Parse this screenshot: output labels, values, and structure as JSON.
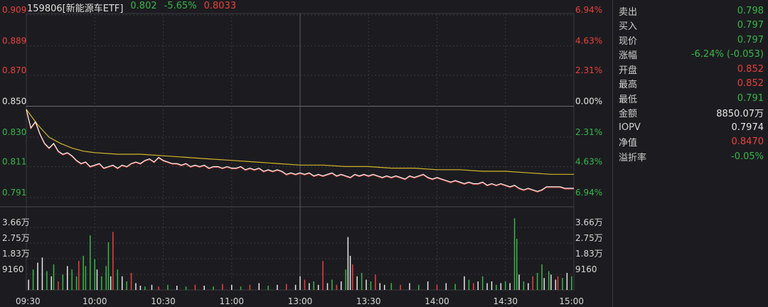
{
  "header": {
    "name": "159806[新能源车ETF]",
    "price": "0.802",
    "change_pct": "-5.65%",
    "avg_price": "0.8033"
  },
  "quote": [
    {
      "label": "卖出",
      "value": "0.798",
      "color": "green"
    },
    {
      "label": "买入",
      "value": "0.797",
      "color": "green"
    },
    {
      "label": "现价",
      "value": "0.797",
      "color": "green"
    },
    {
      "label": "涨幅",
      "value": "-6.24% (-0.053)",
      "color": "green"
    },
    {
      "label": "开盘",
      "value": "0.852",
      "color": "red"
    },
    {
      "label": "最高",
      "value": "0.852",
      "color": "red"
    },
    {
      "label": "最低",
      "value": "0.791",
      "color": "green"
    },
    {
      "label": "金额",
      "value": "8850.07万",
      "color": "white"
    },
    {
      "label": "IOPV",
      "value": "0.7974",
      "color": "white"
    },
    {
      "label": "净值",
      "value": "0.8470",
      "color": "red"
    },
    {
      "label": "溢折率",
      "value": "-0.05%",
      "color": "green"
    }
  ],
  "colors": {
    "up": "#e8413c",
    "down": "#39b54a",
    "flat": "#e6e6e6",
    "avg_line": "#d4b42a",
    "price_line": "#ffffff",
    "grid": "#3a3a3e"
  },
  "chart_data": {
    "type": "line",
    "prev_close": 0.85,
    "price_axis": {
      "ylim": [
        0.791,
        0.909
      ],
      "left_ticks": [
        {
          "value": 0.909,
          "label": "0.909",
          "color": "red"
        },
        {
          "value": 0.889,
          "label": "0.889",
          "color": "red"
        },
        {
          "value": 0.87,
          "label": "0.870",
          "color": "red"
        },
        {
          "value": 0.85,
          "label": "0.850",
          "color": "white"
        },
        {
          "value": 0.83,
          "label": "0.830",
          "color": "green"
        },
        {
          "value": 0.811,
          "label": "0.811",
          "color": "green"
        },
        {
          "value": 0.791,
          "label": "0.791",
          "color": "green"
        }
      ],
      "right_ticks": [
        {
          "value": 0.909,
          "label": "6.94%",
          "color": "red"
        },
        {
          "value": 0.889,
          "label": "4.63%",
          "color": "red"
        },
        {
          "value": 0.87,
          "label": "2.31%",
          "color": "red"
        },
        {
          "value": 0.85,
          "label": "0.00%",
          "color": "white"
        },
        {
          "value": 0.83,
          "label": "2.31%",
          "color": "green"
        },
        {
          "value": 0.811,
          "label": "4.63%",
          "color": "green"
        },
        {
          "value": 0.791,
          "label": "6.94%",
          "color": "green"
        }
      ]
    },
    "volume_axis": {
      "ylim": [
        0,
        45000
      ],
      "ticks": [
        {
          "value": 36600,
          "label": "3.66万"
        },
        {
          "value": 27500,
          "label": "2.75万"
        },
        {
          "value": 18300,
          "label": "1.83万"
        },
        {
          "value": 9160,
          "label": "9160"
        }
      ]
    },
    "x_ticks": [
      "09:30",
      "10:00",
      "10:30",
      "11:00",
      "13:00",
      "13:30",
      "14:00",
      "14:30",
      "15:00"
    ],
    "price_series": {
      "name": "price",
      "points": [
        [
          0,
          0.848
        ],
        [
          2,
          0.836
        ],
        [
          4,
          0.84
        ],
        [
          6,
          0.832
        ],
        [
          8,
          0.826
        ],
        [
          10,
          0.823
        ],
        [
          12,
          0.826
        ],
        [
          14,
          0.821
        ],
        [
          16,
          0.819
        ],
        [
          18,
          0.82
        ],
        [
          20,
          0.818
        ],
        [
          22,
          0.815
        ],
        [
          24,
          0.813
        ],
        [
          26,
          0.814
        ],
        [
          28,
          0.811
        ],
        [
          30,
          0.812
        ],
        [
          32,
          0.813
        ],
        [
          34,
          0.81
        ],
        [
          36,
          0.811
        ],
        [
          38,
          0.812
        ],
        [
          40,
          0.81
        ],
        [
          42,
          0.812
        ],
        [
          44,
          0.811
        ],
        [
          46,
          0.813
        ],
        [
          48,
          0.814
        ],
        [
          50,
          0.813
        ],
        [
          52,
          0.815
        ],
        [
          54,
          0.816
        ],
        [
          56,
          0.814
        ],
        [
          58,
          0.817
        ],
        [
          60,
          0.815
        ],
        [
          62,
          0.814
        ],
        [
          64,
          0.813
        ],
        [
          66,
          0.813
        ],
        [
          68,
          0.812
        ],
        [
          70,
          0.813
        ],
        [
          72,
          0.811
        ],
        [
          74,
          0.812
        ],
        [
          76,
          0.811
        ],
        [
          78,
          0.812
        ],
        [
          80,
          0.81
        ],
        [
          82,
          0.811
        ],
        [
          84,
          0.811
        ],
        [
          86,
          0.81
        ],
        [
          88,
          0.811
        ],
        [
          90,
          0.81
        ],
        [
          92,
          0.81
        ],
        [
          94,
          0.811
        ],
        [
          96,
          0.809
        ],
        [
          98,
          0.81
        ],
        [
          100,
          0.809
        ],
        [
          102,
          0.81
        ],
        [
          104,
          0.808
        ],
        [
          106,
          0.809
        ],
        [
          108,
          0.808
        ],
        [
          110,
          0.809
        ],
        [
          112,
          0.808
        ],
        [
          114,
          0.806
        ],
        [
          116,
          0.807
        ],
        [
          118,
          0.806
        ],
        [
          120,
          0.807
        ],
        [
          122,
          0.806
        ],
        [
          124,
          0.807
        ],
        [
          126,
          0.805
        ],
        [
          128,
          0.806
        ],
        [
          130,
          0.805
        ],
        [
          132,
          0.806
        ],
        [
          134,
          0.807
        ],
        [
          136,
          0.805
        ],
        [
          138,
          0.806
        ],
        [
          140,
          0.805
        ],
        [
          142,
          0.804
        ],
        [
          144,
          0.806
        ],
        [
          146,
          0.805
        ],
        [
          148,
          0.806
        ],
        [
          150,
          0.805
        ],
        [
          152,
          0.806
        ],
        [
          154,
          0.805
        ],
        [
          156,
          0.804
        ],
        [
          158,
          0.805
        ],
        [
          160,
          0.804
        ],
        [
          162,
          0.805
        ],
        [
          164,
          0.804
        ],
        [
          166,
          0.803
        ],
        [
          168,
          0.805
        ],
        [
          170,
          0.804
        ],
        [
          172,
          0.805
        ],
        [
          174,
          0.806
        ],
        [
          176,
          0.804
        ],
        [
          178,
          0.803
        ],
        [
          180,
          0.804
        ],
        [
          182,
          0.803
        ],
        [
          184,
          0.802
        ],
        [
          186,
          0.801
        ],
        [
          188,
          0.802
        ],
        [
          190,
          0.801
        ],
        [
          192,
          0.8
        ],
        [
          194,
          0.801
        ],
        [
          196,
          0.8
        ],
        [
          198,
          0.8
        ],
        [
          200,
          0.801
        ],
        [
          202,
          0.799
        ],
        [
          204,
          0.8
        ],
        [
          206,
          0.799
        ],
        [
          208,
          0.8
        ],
        [
          210,
          0.799
        ],
        [
          212,
          0.798
        ],
        [
          214,
          0.799
        ],
        [
          216,
          0.797
        ],
        [
          218,
          0.796
        ],
        [
          220,
          0.797
        ],
        [
          222,
          0.796
        ],
        [
          224,
          0.795
        ],
        [
          226,
          0.796
        ],
        [
          228,
          0.798
        ],
        [
          230,
          0.798
        ],
        [
          232,
          0.798
        ],
        [
          234,
          0.798
        ],
        [
          236,
          0.797
        ],
        [
          238,
          0.797
        ],
        [
          240,
          0.797
        ]
      ]
    },
    "avg_series": {
      "name": "average",
      "points": [
        [
          0,
          0.848
        ],
        [
          5,
          0.838
        ],
        [
          10,
          0.83
        ],
        [
          15,
          0.826
        ],
        [
          20,
          0.823
        ],
        [
          25,
          0.821
        ],
        [
          30,
          0.82
        ],
        [
          40,
          0.819
        ],
        [
          50,
          0.819
        ],
        [
          60,
          0.818
        ],
        [
          70,
          0.817
        ],
        [
          80,
          0.816
        ],
        [
          90,
          0.815
        ],
        [
          100,
          0.814
        ],
        [
          110,
          0.813
        ],
        [
          120,
          0.812
        ],
        [
          130,
          0.812
        ],
        [
          140,
          0.811
        ],
        [
          150,
          0.811
        ],
        [
          160,
          0.81
        ],
        [
          170,
          0.81
        ],
        [
          180,
          0.809
        ],
        [
          190,
          0.809
        ],
        [
          200,
          0.808
        ],
        [
          210,
          0.808
        ],
        [
          220,
          0.807
        ],
        [
          230,
          0.806
        ],
        [
          240,
          0.806
        ]
      ]
    },
    "volume_series": {
      "name": "volume",
      "bars": [
        [
          1,
          6000,
          "w"
        ],
        [
          3,
          12000,
          "g"
        ],
        [
          5,
          16000,
          "w"
        ],
        [
          7,
          19000,
          "w"
        ],
        [
          9,
          11000,
          "g"
        ],
        [
          11,
          8000,
          "w"
        ],
        [
          12,
          15000,
          "g"
        ],
        [
          14,
          5000,
          "r"
        ],
        [
          16,
          9000,
          "g"
        ],
        [
          18,
          14000,
          "w"
        ],
        [
          20,
          12000,
          "g"
        ],
        [
          22,
          8000,
          "g"
        ],
        [
          23,
          17000,
          "r"
        ],
        [
          25,
          20000,
          "g"
        ],
        [
          26,
          14000,
          "g"
        ],
        [
          28,
          32000,
          "g"
        ],
        [
          30,
          18000,
          "g"
        ],
        [
          31,
          12000,
          "w"
        ],
        [
          33,
          8000,
          "g"
        ],
        [
          35,
          14000,
          "g"
        ],
        [
          36,
          28000,
          "g"
        ],
        [
          37,
          8000,
          "w"
        ],
        [
          38,
          34000,
          "r"
        ],
        [
          40,
          12000,
          "g"
        ],
        [
          42,
          8000,
          "w"
        ],
        [
          44,
          5000,
          "g"
        ],
        [
          46,
          10000,
          "r"
        ],
        [
          48,
          4000,
          "w"
        ],
        [
          50,
          2500,
          "w"
        ],
        [
          52,
          2000,
          "g"
        ],
        [
          55,
          3000,
          "w"
        ],
        [
          58,
          2000,
          "r"
        ],
        [
          62,
          3000,
          "g"
        ],
        [
          66,
          2500,
          "w"
        ],
        [
          70,
          2000,
          "g"
        ],
        [
          74,
          3000,
          "r"
        ],
        [
          78,
          2500,
          "w"
        ],
        [
          82,
          2000,
          "g"
        ],
        [
          86,
          3500,
          "r"
        ],
        [
          90,
          3000,
          "w"
        ],
        [
          94,
          2000,
          "g"
        ],
        [
          98,
          3000,
          "r"
        ],
        [
          102,
          4000,
          "w"
        ],
        [
          106,
          2500,
          "g"
        ],
        [
          110,
          3000,
          "w"
        ],
        [
          114,
          3500,
          "r"
        ],
        [
          118,
          3000,
          "w"
        ],
        [
          120,
          8000,
          "w"
        ],
        [
          122,
          6000,
          "r"
        ],
        [
          124,
          4000,
          "w"
        ],
        [
          126,
          5000,
          "g"
        ],
        [
          128,
          3000,
          "w"
        ],
        [
          130,
          17000,
          "r"
        ],
        [
          132,
          4000,
          "w"
        ],
        [
          134,
          6000,
          "g"
        ],
        [
          136,
          3000,
          "r"
        ],
        [
          138,
          5000,
          "w"
        ],
        [
          140,
          12000,
          "g"
        ],
        [
          141,
          31000,
          "w"
        ],
        [
          142,
          20000,
          "w"
        ],
        [
          143,
          15000,
          "r"
        ],
        [
          145,
          8000,
          "w"
        ],
        [
          147,
          10000,
          "g"
        ],
        [
          149,
          6000,
          "w"
        ],
        [
          151,
          5000,
          "g"
        ],
        [
          153,
          9000,
          "r"
        ],
        [
          155,
          4000,
          "w"
        ],
        [
          157,
          3000,
          "w"
        ],
        [
          160,
          4000,
          "g"
        ],
        [
          164,
          3000,
          "r"
        ],
        [
          168,
          4000,
          "w"
        ],
        [
          172,
          3000,
          "g"
        ],
        [
          176,
          5000,
          "w"
        ],
        [
          180,
          3000,
          "r"
        ],
        [
          184,
          4000,
          "w"
        ],
        [
          188,
          3500,
          "g"
        ],
        [
          192,
          8000,
          "w"
        ],
        [
          194,
          6000,
          "g"
        ],
        [
          196,
          4000,
          "r"
        ],
        [
          198,
          5000,
          "w"
        ],
        [
          200,
          8000,
          "g"
        ],
        [
          202,
          4000,
          "w"
        ],
        [
          204,
          5000,
          "w"
        ],
        [
          206,
          3000,
          "g"
        ],
        [
          208,
          4000,
          "w"
        ],
        [
          210,
          5000,
          "g"
        ],
        [
          212,
          4000,
          "w"
        ],
        [
          214,
          42000,
          "g"
        ],
        [
          215,
          30000,
          "g"
        ],
        [
          216,
          9000,
          "w"
        ],
        [
          218,
          5000,
          "g"
        ],
        [
          220,
          4000,
          "w"
        ],
        [
          222,
          8000,
          "r"
        ],
        [
          224,
          10000,
          "g"
        ],
        [
          226,
          15000,
          "g"
        ],
        [
          227,
          7000,
          "w"
        ],
        [
          229,
          11000,
          "g"
        ],
        [
          230,
          9000,
          "w"
        ],
        [
          232,
          6000,
          "w"
        ],
        [
          233,
          8000,
          "r"
        ],
        [
          235,
          7000,
          "g"
        ],
        [
          237,
          10000,
          "w"
        ],
        [
          239,
          8000,
          "g"
        ]
      ]
    }
  }
}
